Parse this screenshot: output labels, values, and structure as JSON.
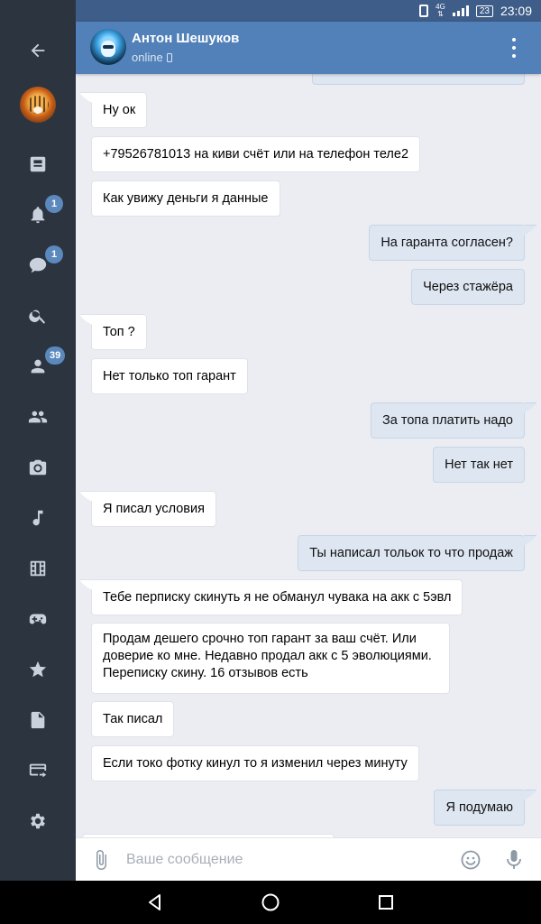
{
  "status_bar": {
    "network": "4G",
    "battery": "23",
    "time": "23:09"
  },
  "header": {
    "name": "Антон Шешуков",
    "status": "online"
  },
  "sidebar": {
    "items": [
      {
        "name": "back-icon",
        "badge": ""
      },
      {
        "name": "avatar",
        "badge": ""
      },
      {
        "name": "news-icon",
        "badge": ""
      },
      {
        "name": "notifications-icon",
        "badge": "1"
      },
      {
        "name": "messages-icon",
        "badge": "1"
      },
      {
        "name": "search-icon",
        "badge": ""
      },
      {
        "name": "friends-icon",
        "badge": "39"
      },
      {
        "name": "groups-icon",
        "badge": ""
      },
      {
        "name": "photos-icon",
        "badge": ""
      },
      {
        "name": "music-icon",
        "badge": ""
      },
      {
        "name": "video-icon",
        "badge": ""
      },
      {
        "name": "games-icon",
        "badge": ""
      },
      {
        "name": "bookmarks-icon",
        "badge": ""
      },
      {
        "name": "documents-icon",
        "badge": ""
      },
      {
        "name": "payments-icon",
        "badge": ""
      },
      {
        "name": "settings-icon",
        "badge": ""
      }
    ]
  },
  "messages": [
    {
      "dir": "in",
      "text": "Ну ок"
    },
    {
      "dir": "in",
      "text": "+79526781013 на киви счёт или на телефон теле2"
    },
    {
      "dir": "in",
      "text": "Как увижу деньги я данные"
    },
    {
      "dir": "out",
      "text": "На гаранта согласен?"
    },
    {
      "dir": "out",
      "text": "Через стажёра"
    },
    {
      "dir": "in",
      "text": "Топ ?"
    },
    {
      "dir": "in",
      "text": "Нет только топ гарант"
    },
    {
      "dir": "out",
      "text": "За топа платить надо"
    },
    {
      "dir": "out",
      "text": "Нет так нет"
    },
    {
      "dir": "in",
      "text": "Я писал условия"
    },
    {
      "dir": "out",
      "text": "Ты написал тольок то что продаж"
    },
    {
      "dir": "in",
      "text": "Тебе перписку скинуть я не обманул чувака на акк с 5эвл"
    },
    {
      "dir": "in",
      "lines": [
        "Продам дешего срочно топ гарант за ваш счёт. Или",
        "доверие ко мне. Недавно продал акк с 5 эволюциями.",
        "Переписку скину. 16 отзывов есть"
      ]
    },
    {
      "dir": "in",
      "text": "Так писал"
    },
    {
      "dir": "in",
      "text": "Если токо фотку кинул то я изменил через минуту"
    },
    {
      "dir": "out",
      "text": "Я подумаю"
    }
  ],
  "composer": {
    "placeholder": "Ваше сообщение"
  },
  "colors": {
    "header": "#5181b8",
    "sidebar": "#2c3440",
    "chat_bg": "#ebedf2",
    "outgoing": "#dde6f1",
    "incoming": "#ffffff",
    "badge": "#5b88bd"
  }
}
